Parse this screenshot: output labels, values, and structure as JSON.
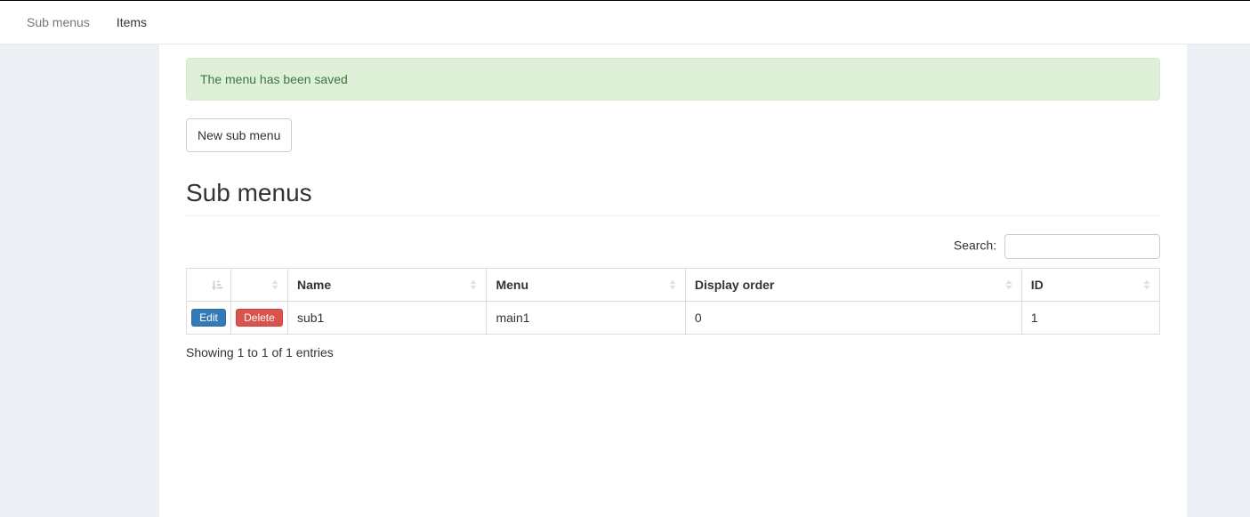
{
  "nav": {
    "tabs": [
      {
        "label": "Sub menus",
        "active": false
      },
      {
        "label": "Items",
        "active": true
      }
    ]
  },
  "alert": {
    "message": "The menu has been saved"
  },
  "buttons": {
    "new_sub_menu": "New sub menu",
    "edit": "Edit",
    "delete": "Delete"
  },
  "page": {
    "title": "Sub menus"
  },
  "search": {
    "label": "Search:",
    "value": ""
  },
  "table": {
    "headers": {
      "edit": "",
      "delete": "",
      "name": "Name",
      "menu": "Menu",
      "display_order": "Display order",
      "id": "ID"
    },
    "rows": [
      {
        "name": "sub1",
        "menu": "main1",
        "display_order": "0",
        "id": "1"
      }
    ],
    "info": "Showing 1 to 1 of 1 entries"
  }
}
